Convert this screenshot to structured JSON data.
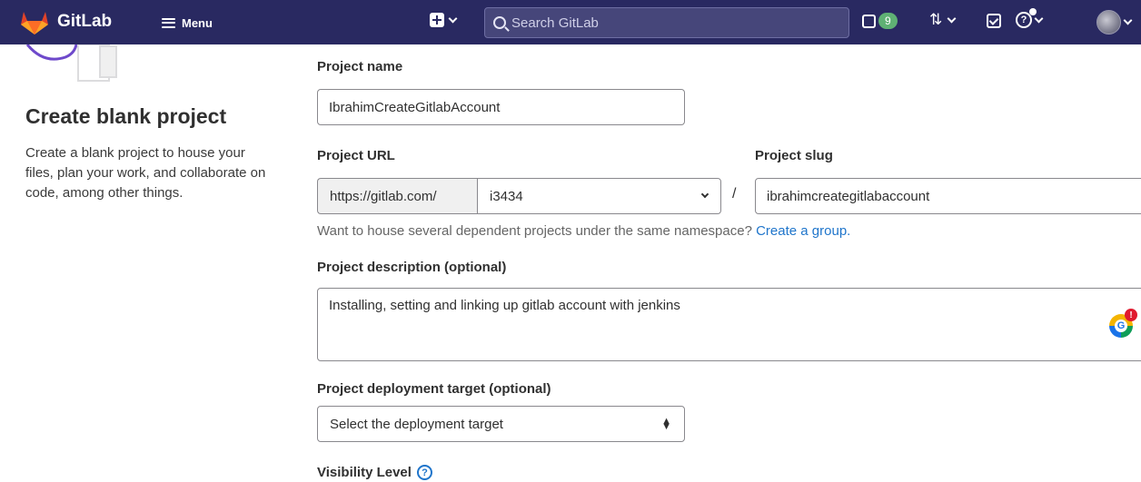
{
  "nav": {
    "brand": "GitLab",
    "menu_label": "Menu",
    "search_placeholder": "Search GitLab",
    "issues_count": "9",
    "brand_color": "#292961",
    "icons": [
      "gitlab-logo-icon",
      "hamburger-icon",
      "plus-square-icon",
      "search-icon",
      "issues-icon",
      "merge-request-icon",
      "todo-icon",
      "help-icon",
      "avatar"
    ]
  },
  "intro": {
    "title": "Create blank project",
    "description": "Create a blank project to house your files, plan your work, and collaborate on code, among other things."
  },
  "form": {
    "project_name_label": "Project name",
    "project_name_value": "IbrahimCreateGitlabAccount",
    "project_url_label": "Project URL",
    "url_prefix": "https://gitlab.com/",
    "namespace_value": "i3434",
    "url_separator": "/",
    "project_slug_label": "Project slug",
    "project_slug_value": "ibrahimcreategitlabaccount",
    "namespace_help": "Want to house several dependent projects under the same namespace?",
    "namespace_help_link": "Create a group.",
    "description_label": "Project description (optional)",
    "description_value": "Installing, setting and linking up gitlab account with jenkins",
    "deployment_label": "Project deployment target (optional)",
    "deployment_placeholder": "Select the deployment target",
    "visibility_label": "Visibility Level",
    "link_color": "#1f75cb"
  },
  "grammarly": {
    "badge": "!"
  }
}
